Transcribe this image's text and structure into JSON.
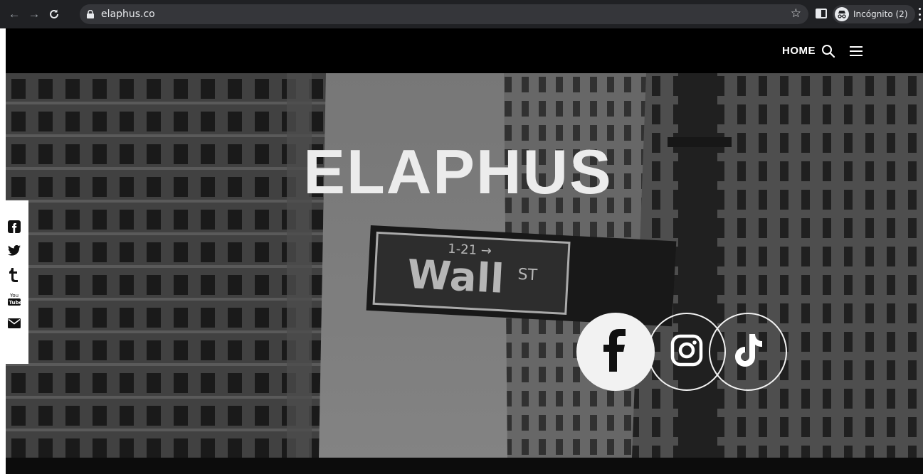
{
  "browser": {
    "url": "elaphus.co",
    "profile_label": "Incógnito (2)",
    "icons": [
      "back-icon",
      "forward-icon",
      "reload-icon",
      "lock-icon",
      "star-icon",
      "side-panel-icon",
      "incognito-icon",
      "menu-kebab-icon"
    ]
  },
  "header": {
    "nav_home": "HOME",
    "icons": [
      "search-icon",
      "hamburger-menu-icon"
    ]
  },
  "hero": {
    "title": "ELAPHUS",
    "background": "grayscale photo of Wall Street sign between buildings",
    "social_links": [
      {
        "name": "facebook",
        "icon": "facebook-icon"
      },
      {
        "name": "instagram",
        "icon": "instagram-icon"
      },
      {
        "name": "tiktok",
        "icon": "tiktok-icon"
      }
    ]
  },
  "share_bar": {
    "items": [
      "facebook-icon",
      "twitter-icon",
      "tumblr-icon",
      "youtube-icon",
      "email-icon"
    ]
  },
  "colors": {
    "chrome_bg": "#202124",
    "omnibox_bg": "#35363a",
    "header_bg": "#000000",
    "title_color": "#ececec"
  }
}
